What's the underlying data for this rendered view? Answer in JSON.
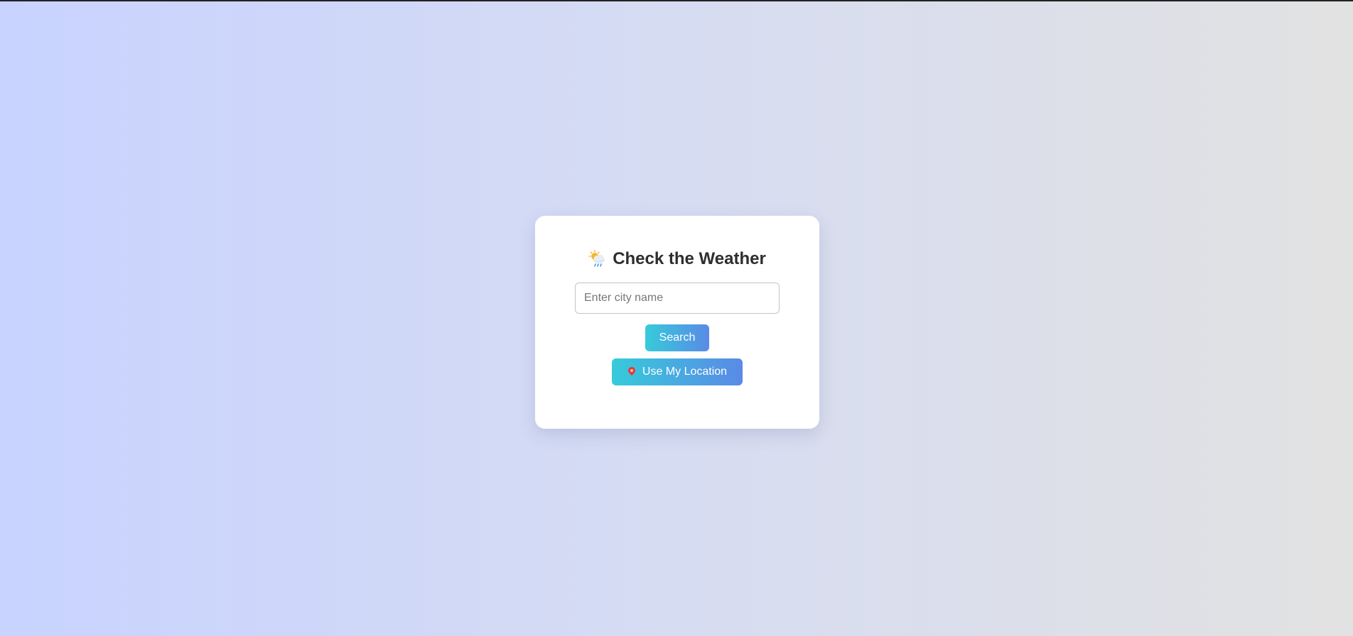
{
  "card": {
    "title_icon": "sun-behind-rain-cloud-icon",
    "title": "Check the Weather",
    "city_input": {
      "value": "",
      "placeholder": "Enter city name"
    },
    "search_label": "Search",
    "location_icon": "pin-icon",
    "location_label": "Use My Location"
  },
  "colors": {
    "button_gradient_start": "#36cbdb",
    "button_gradient_end": "#5a8ae6",
    "title_text": "#2e2e2e",
    "card_background": "#ffffff"
  }
}
